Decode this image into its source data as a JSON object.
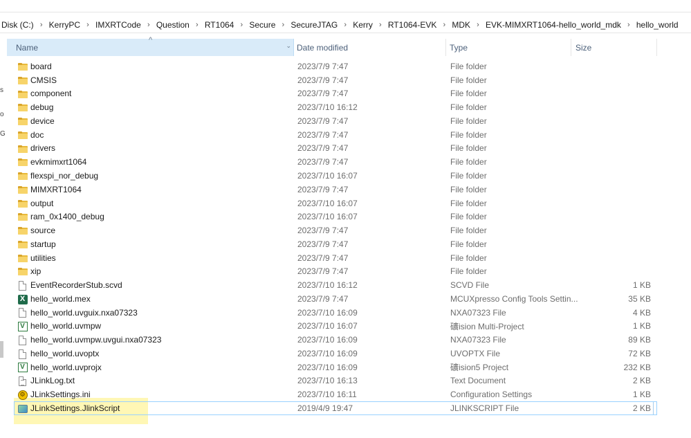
{
  "breadcrumb": {
    "items": [
      "Disk (C:)",
      "KerryPC",
      "IMXRTCode",
      "Question",
      "RT1064",
      "Secure",
      "SecureJTAG",
      "Kerry",
      "RT1064-EVK",
      "MDK",
      "EVK-MIMXRT1064-hello_world_mdk",
      "hello_world"
    ],
    "separator": "›"
  },
  "left_pane": {
    "fragments": [
      "s",
      "o",
      "G"
    ]
  },
  "columns": {
    "name": "Name",
    "date": "Date modified",
    "type": "Type",
    "size": "Size",
    "sort_icon": "chevron-up-icon",
    "sort_glyph": "^",
    "dropdown_glyph": "⌄"
  },
  "files": [
    {
      "name": "board",
      "date": "2023/7/9 7:47",
      "type": "File folder",
      "size": "",
      "icon": "folder-icon"
    },
    {
      "name": "CMSIS",
      "date": "2023/7/9 7:47",
      "type": "File folder",
      "size": "",
      "icon": "folder-icon"
    },
    {
      "name": "component",
      "date": "2023/7/9 7:47",
      "type": "File folder",
      "size": "",
      "icon": "folder-icon"
    },
    {
      "name": "debug",
      "date": "2023/7/10 16:12",
      "type": "File folder",
      "size": "",
      "icon": "folder-icon"
    },
    {
      "name": "device",
      "date": "2023/7/9 7:47",
      "type": "File folder",
      "size": "",
      "icon": "folder-icon"
    },
    {
      "name": "doc",
      "date": "2023/7/9 7:47",
      "type": "File folder",
      "size": "",
      "icon": "folder-icon"
    },
    {
      "name": "drivers",
      "date": "2023/7/9 7:47",
      "type": "File folder",
      "size": "",
      "icon": "folder-icon"
    },
    {
      "name": "evkmimxrt1064",
      "date": "2023/7/9 7:47",
      "type": "File folder",
      "size": "",
      "icon": "folder-icon"
    },
    {
      "name": "flexspi_nor_debug",
      "date": "2023/7/10 16:07",
      "type": "File folder",
      "size": "",
      "icon": "folder-icon"
    },
    {
      "name": "MIMXRT1064",
      "date": "2023/7/9 7:47",
      "type": "File folder",
      "size": "",
      "icon": "folder-icon"
    },
    {
      "name": "output",
      "date": "2023/7/10 16:07",
      "type": "File folder",
      "size": "",
      "icon": "folder-icon"
    },
    {
      "name": "ram_0x1400_debug",
      "date": "2023/7/10 16:07",
      "type": "File folder",
      "size": "",
      "icon": "folder-icon"
    },
    {
      "name": "source",
      "date": "2023/7/9 7:47",
      "type": "File folder",
      "size": "",
      "icon": "folder-icon"
    },
    {
      "name": "startup",
      "date": "2023/7/9 7:47",
      "type": "File folder",
      "size": "",
      "icon": "folder-icon"
    },
    {
      "name": "utilities",
      "date": "2023/7/9 7:47",
      "type": "File folder",
      "size": "",
      "icon": "folder-icon"
    },
    {
      "name": "xip",
      "date": "2023/7/9 7:47",
      "type": "File folder",
      "size": "",
      "icon": "folder-icon"
    },
    {
      "name": "EventRecorderStub.scvd",
      "date": "2023/7/10 16:12",
      "type": "SCVD File",
      "size": "1 KB",
      "icon": "document-icon"
    },
    {
      "name": "hello_world.mex",
      "date": "2023/7/9 7:47",
      "type": "MCUXpresso Config Tools Settin...",
      "size": "35 KB",
      "icon": "mcuxpresso-config-icon"
    },
    {
      "name": "hello_world.uvguix.nxa07323",
      "date": "2023/7/10 16:09",
      "type": "NXA07323 File",
      "size": "4 KB",
      "icon": "document-icon"
    },
    {
      "name": "hello_world.uvmpw",
      "date": "2023/7/10 16:07",
      "type": "礦ision Multi-Project",
      "size": "1 KB",
      "icon": "uvision-icon"
    },
    {
      "name": "hello_world.uvmpw.uvgui.nxa07323",
      "date": "2023/7/10 16:09",
      "type": "NXA07323 File",
      "size": "89 KB",
      "icon": "document-icon"
    },
    {
      "name": "hello_world.uvoptx",
      "date": "2023/7/10 16:09",
      "type": "UVOPTX File",
      "size": "72 KB",
      "icon": "document-icon"
    },
    {
      "name": "hello_world.uvprojx",
      "date": "2023/7/10 16:09",
      "type": "礦ision5 Project",
      "size": "232 KB",
      "icon": "uvision-icon"
    },
    {
      "name": "JLinkLog.txt",
      "date": "2023/7/10 16:13",
      "type": "Text Document",
      "size": "2 KB",
      "icon": "text-document-icon"
    },
    {
      "name": "JLinkSettings.ini",
      "date": "2023/7/10 16:11",
      "type": "Configuration Settings",
      "size": "1 KB",
      "icon": "config-settings-icon"
    },
    {
      "name": "JLinkSettings.JlinkScript",
      "date": "2019/4/9 19:47",
      "type": "JLINKSCRIPT File",
      "size": "2 KB",
      "icon": "jlinkscript-icon",
      "selected": true
    }
  ],
  "colors": {
    "folder": "#e8b93a",
    "header_sorted_bg": "#d9ebf9",
    "selection_border": "#99d1ff",
    "highlight": "#fff078",
    "header_text": "#4c607a"
  }
}
